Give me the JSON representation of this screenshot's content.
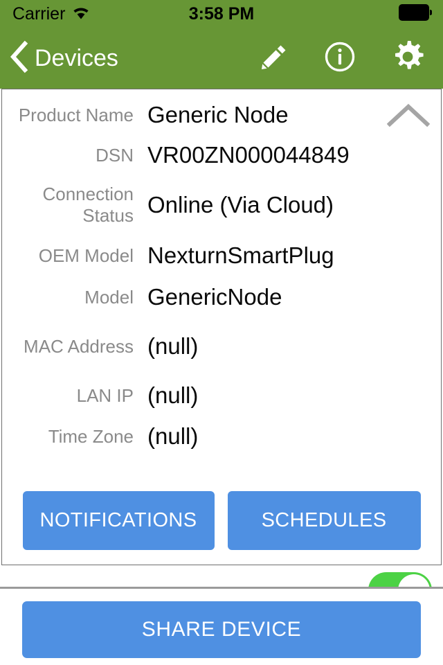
{
  "status_bar": {
    "carrier": "Carrier",
    "wifi_icon": "wifi-icon",
    "time": "3:58 PM",
    "battery_icon": "battery-full-icon"
  },
  "nav_bar": {
    "back_icon": "chevron-left-icon",
    "back_label": "Devices",
    "actions": [
      {
        "name": "edit-button",
        "icon": "pencil-icon"
      },
      {
        "name": "info-button",
        "icon": "info-circle-icon"
      },
      {
        "name": "settings-button",
        "icon": "gear-icon"
      }
    ]
  },
  "detail_card": {
    "collapse_icon": "chevron-up-icon",
    "rows": [
      {
        "label": "Product Name",
        "value": "Generic Node"
      },
      {
        "label": "DSN",
        "value": "VR00ZN000044849"
      },
      {
        "label": "Connection Status",
        "value": "Online (Via Cloud)"
      },
      {
        "label": "OEM Model",
        "value": "NexturnSmartPlug"
      },
      {
        "label": "Model",
        "value": "GenericNode"
      },
      {
        "label": "MAC Address",
        "value": "(null)"
      },
      {
        "label": "LAN IP",
        "value": "(null)"
      },
      {
        "label": "Time Zone",
        "value": "(null)"
      }
    ],
    "buttons": {
      "notifications": "NOTIFICATIONS",
      "schedules": "SCHEDULES"
    }
  },
  "toggle": {
    "name": "device-power-toggle",
    "state": "on"
  },
  "bottom_panel": {
    "share_button": "SHARE DEVICE"
  },
  "colors": {
    "nav_green": "#679635",
    "button_blue": "#4f90e2",
    "toggle_green": "#4cd245",
    "label_gray": "#8a8a8a",
    "value_black": "#0a0a0a"
  }
}
